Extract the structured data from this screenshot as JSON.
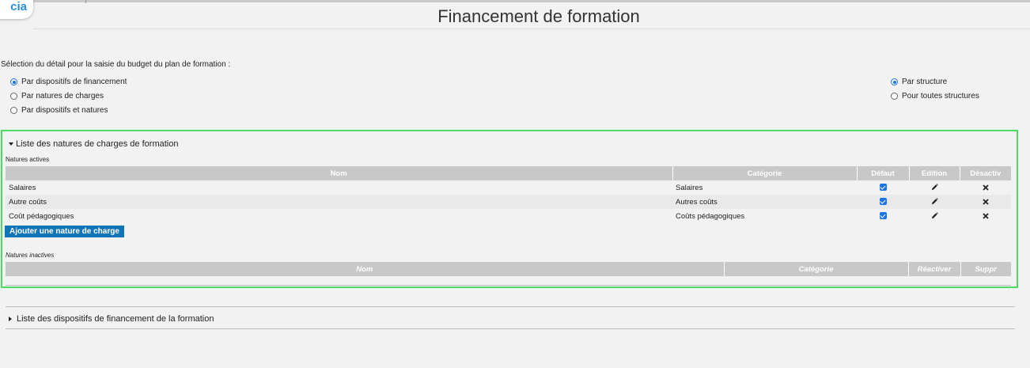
{
  "header": {
    "logo_text": "cia",
    "title": "Financement de formation"
  },
  "selection": {
    "label": "Sélection du détail pour la saisie du budget du plan de formation :",
    "mode_options": [
      {
        "label": "Par dispositifs de financement",
        "checked": true
      },
      {
        "label": "Par natures de charges",
        "checked": false
      },
      {
        "label": "Par dispositifs et natures",
        "checked": false
      }
    ],
    "scope_options": [
      {
        "label": "Par structure",
        "checked": true
      },
      {
        "label": "Pour toutes structures",
        "checked": false
      }
    ]
  },
  "natures_section": {
    "title": "Liste des natures de charges de formation",
    "active_label": "Natures actives",
    "active_columns": [
      "Nom",
      "Catégorie",
      "Défaut",
      "Edition",
      "Désactiv"
    ],
    "active_rows": [
      {
        "nom": "Salaires",
        "categorie": "Salaires",
        "defaut": true
      },
      {
        "nom": "Autre coûts",
        "categorie": "Autres coûts",
        "defaut": true
      },
      {
        "nom": "Coût pédagogiques",
        "categorie": "Coûts pédagogiques",
        "defaut": true
      }
    ],
    "add_button": "Ajouter une nature de charge",
    "inactive_label": "Natures inactives",
    "inactive_columns": [
      "Nom",
      "Catégorie",
      "Réactiver",
      "Suppr"
    ]
  },
  "dispositifs_section": {
    "title": "Liste des dispositifs de financement de la formation"
  },
  "icons": {
    "edit": "pencil-icon",
    "deactivate": "close-x-icon",
    "checkbox": "checkbox-checked-icon"
  },
  "colors": {
    "accent": "#1a73e8",
    "button": "#1074b8",
    "highlight_border": "#4cd964",
    "header_cells": "#c8c8c8"
  }
}
